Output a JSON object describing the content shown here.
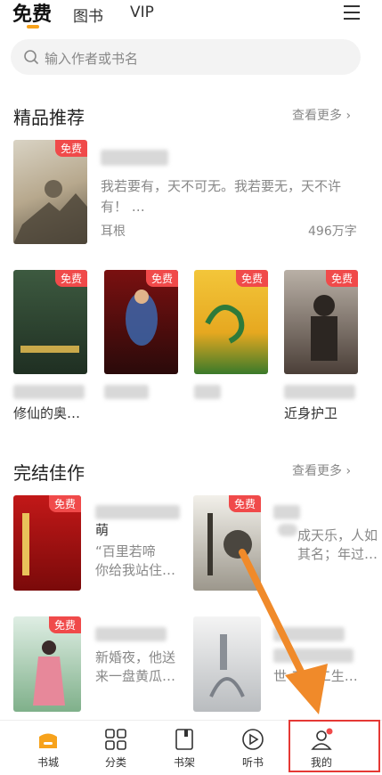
{
  "tabs": {
    "free": "免费",
    "books": "图书",
    "vip": "VIP"
  },
  "search": {
    "placeholder": "输入作者或书名"
  },
  "featured": {
    "title": "精品推荐",
    "more": "查看更多",
    "top_book": {
      "badge": "免费",
      "desc_line1": "我若要有，天不可无。我若要无，天不许",
      "desc_line2": "有！ …",
      "author": "耳根",
      "count": "496万字"
    },
    "grid": [
      {
        "badge": "免费",
        "title_line2": "修仙的奥…"
      },
      {
        "badge": "免费",
        "title_line2": ""
      },
      {
        "badge": "免费",
        "title_line2": ""
      },
      {
        "badge": "免费",
        "title_line2": "近身护卫"
      }
    ]
  },
  "completed": {
    "title": "完结佳作",
    "more": "查看更多",
    "books": [
      {
        "badge": "免费",
        "title_line2": "萌",
        "desc_line1": "“百里若啼",
        "desc_line2": "你给我站住…"
      },
      {
        "badge": "免费",
        "desc_line1": "成天乐，人如",
        "desc_line2": "其名；年过…"
      },
      {
        "badge": "免费",
        "desc_line1": "新婚夜，他送",
        "desc_line2": "来一盘黄瓜…"
      },
      {
        "badge": "",
        "desc_line1": "",
        "desc_line2": "世 二十二生…"
      }
    ]
  },
  "nav": {
    "bookstore": "书城",
    "category": "分类",
    "shelf": "书架",
    "listen": "听书",
    "mine": "我的"
  },
  "colors": {
    "accent": "#f7a21b",
    "badge": "#f04a4a",
    "annotation": "#f08a2a",
    "highlight": "#e53935"
  }
}
